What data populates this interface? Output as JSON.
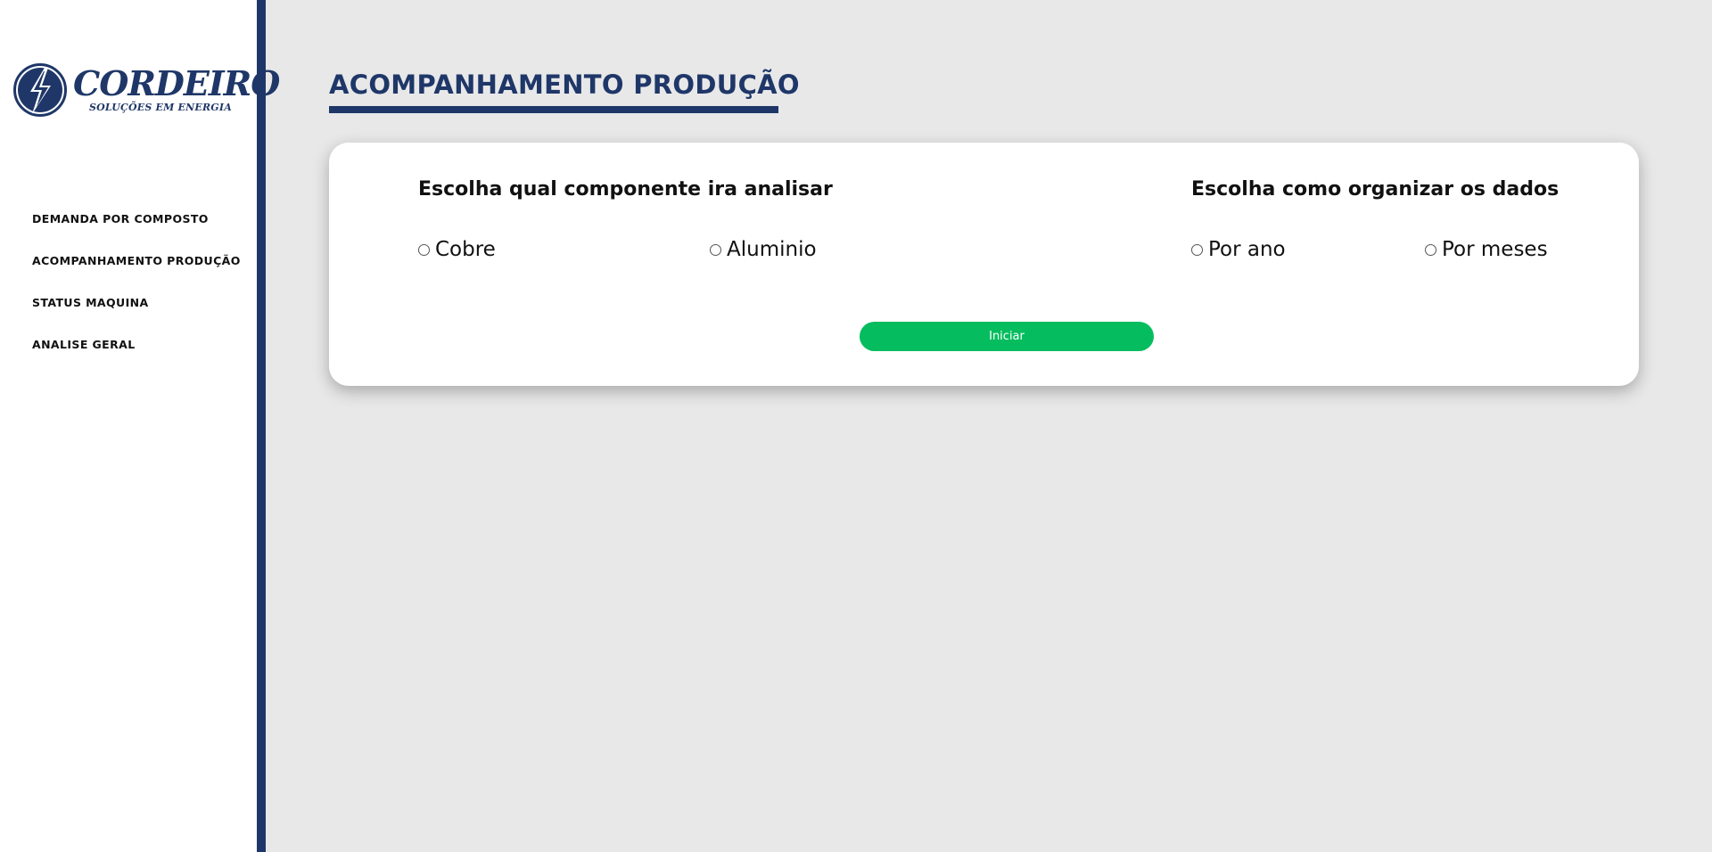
{
  "brand": {
    "name": "CORDEIRO",
    "tagline": "SOLUÇÕES EM ENERGIA",
    "primary_color": "#1f3768",
    "accent_color": "#05bd5e",
    "logo_icon": "lightning-bolt-circle-icon"
  },
  "sidebar": {
    "items": [
      {
        "label": "DEMANDA POR COMPOSTO"
      },
      {
        "label": "ACOMPANHAMENTO PRODUÇÃO"
      },
      {
        "label": "STATUS MAQUINA"
      },
      {
        "label": "ANALISE GERAL"
      }
    ]
  },
  "main": {
    "title": "ACOMPANHAMENTO PRODUÇÃO",
    "component_group": {
      "heading": "Escolha qual componente ira analisar",
      "options": [
        "Cobre",
        "Aluminio"
      ]
    },
    "organize_group": {
      "heading": "Escolha como organizar os dados",
      "options": [
        "Por ano",
        "Por meses"
      ]
    },
    "start_button": "Iniciar"
  }
}
